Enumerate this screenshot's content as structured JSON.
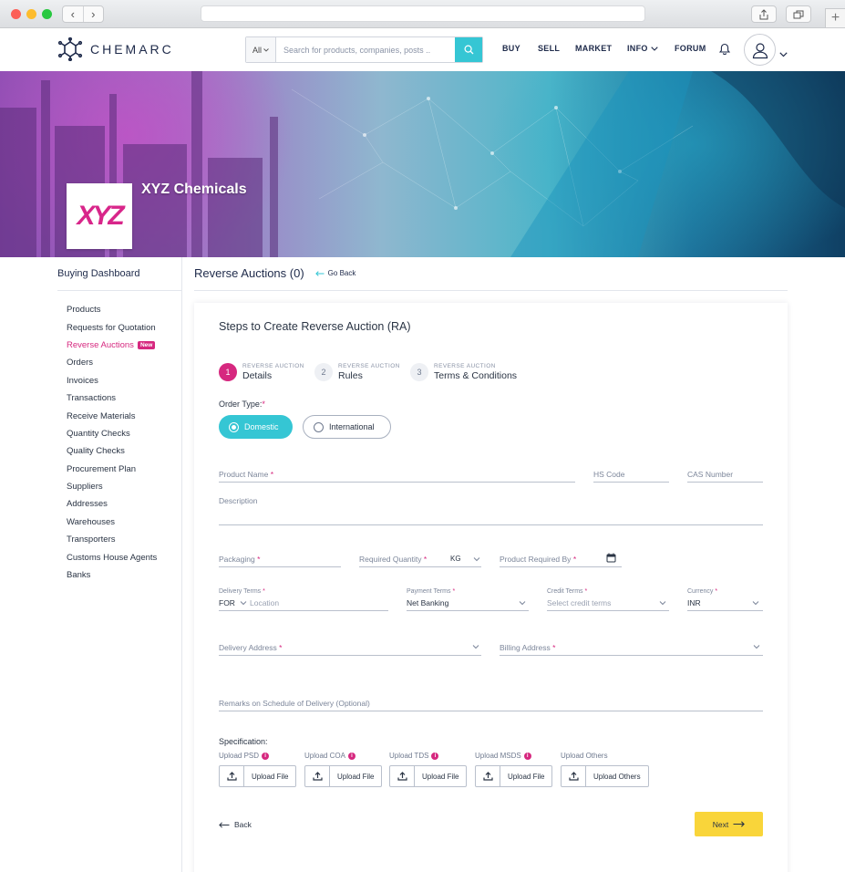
{
  "colors": {
    "accent_teal": "#35c6d4",
    "accent_pink": "#d6287f",
    "brand_navy": "#1e2a4a",
    "next_yellow": "#f9d53a"
  },
  "browser": {
    "back_icon": "chevron-left-icon",
    "forward_icon": "chevron-right-icon",
    "share_icon": "share-icon",
    "tabs_icon": "tabs-icon",
    "new_tab_icon": "plus-icon"
  },
  "header": {
    "brand": "CHEMARC",
    "search": {
      "category": "All",
      "placeholder": "Search for products, companies, posts .."
    },
    "nav": [
      "BUY",
      "SELL",
      "MARKET",
      "INFO",
      "FORUM"
    ]
  },
  "banner": {
    "company_logo_text": "XYZ",
    "company_name": "XYZ Chemicals"
  },
  "sidebar": {
    "title": "Buying Dashboard",
    "items": [
      {
        "label": "Products"
      },
      {
        "label": "Requests for Quotation"
      },
      {
        "label": "Reverse Auctions",
        "badge": "New"
      },
      {
        "label": "Orders"
      },
      {
        "label": "Invoices"
      },
      {
        "label": "Transactions"
      },
      {
        "label": "Receive Materials"
      },
      {
        "label": "Quantity Checks"
      },
      {
        "label": "Quality Checks"
      },
      {
        "label": "Procurement Plan"
      },
      {
        "label": "Suppliers"
      },
      {
        "label": "Addresses"
      },
      {
        "label": "Warehouses"
      },
      {
        "label": "Transporters"
      },
      {
        "label": "Customs House Agents"
      },
      {
        "label": "Banks"
      }
    ]
  },
  "main": {
    "title": "Reverse Auctions (0)",
    "go_back": "Go Back"
  },
  "form": {
    "title": "Steps to Create Reverse Auction (RA)",
    "steps": [
      {
        "number": "1",
        "caption": "REVERSE AUCTION",
        "label": "Details"
      },
      {
        "number": "2",
        "caption": "REVERSE AUCTION",
        "label": "Rules"
      },
      {
        "number": "3",
        "caption": "REVERSE AUCTION",
        "label": "Terms & Conditions"
      }
    ],
    "order_type_label": "Order Type:",
    "order_types": [
      "Domestic",
      "International"
    ],
    "product_name_label": "Product Name",
    "hs_code_label": "HS Code",
    "cas_number_label": "CAS Number",
    "description_label": "Description",
    "packaging_label": "Packaging",
    "required_quantity_label": "Required Quantity",
    "quantity_unit": "KG",
    "product_required_by_label": "Product Required By",
    "delivery_terms_label": "Delivery Terms",
    "delivery_terms_value": "FOR",
    "location_placeholder": "Location",
    "payment_terms_label": "Payment Terms",
    "payment_terms_value": "Net Banking",
    "credit_terms_label": "Credit Terms",
    "credit_terms_placeholder": "Select credit terms",
    "currency_label": "Currency",
    "currency_value": "INR",
    "delivery_address_label": "Delivery Address",
    "billing_address_label": "Billing Address",
    "remarks_label": "Remarks on Schedule of Delivery (Optional)",
    "specification_label": "Specification:",
    "uploads": [
      {
        "label": "Upload PSD",
        "button": "Upload File",
        "info": true
      },
      {
        "label": "Upload COA",
        "button": "Upload File",
        "info": true
      },
      {
        "label": "Upload TDS",
        "button": "Upload File",
        "info": true
      },
      {
        "label": "Upload MSDS",
        "button": "Upload File",
        "info": true
      },
      {
        "label": "Upload Others",
        "button": "Upload Others",
        "info": false
      }
    ],
    "back_label": "Back",
    "next_label": "Next"
  }
}
